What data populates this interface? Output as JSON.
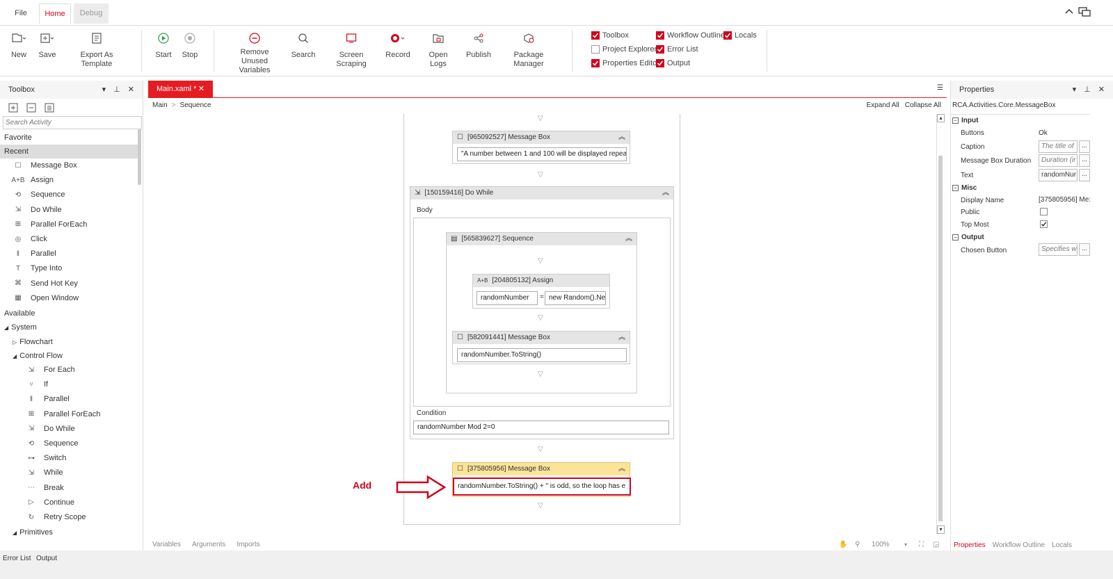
{
  "tabs": {
    "file": "File",
    "home": "Home",
    "debug": "Debug"
  },
  "ribbon": {
    "new": "New",
    "save": "Save",
    "export_template": "Export As Template",
    "start": "Start",
    "stop": "Stop",
    "remove_unused": "Remove Unused Variables",
    "search": "Search",
    "screen_scraping": "Screen Scraping",
    "record": "Record",
    "open_logs": "Open Logs",
    "publish": "Publish",
    "package_manager": "Package Manager",
    "toggles": {
      "toolbox": {
        "label": "Toolbox",
        "checked": true
      },
      "workflow_outline": {
        "label": "Workflow Outline",
        "checked": true
      },
      "locals": {
        "label": "Locals",
        "checked": true
      },
      "project_explorer": {
        "label": "Project Explorer",
        "checked": false
      },
      "error_list": {
        "label": "Error List",
        "checked": true
      },
      "properties_editor": {
        "label": "Properties Editor",
        "checked": true
      },
      "output": {
        "label": "Output",
        "checked": true
      }
    }
  },
  "toolbox": {
    "title": "Toolbox",
    "search_placeholder": "Search Activity",
    "favorite": "Favorite",
    "recent": "Recent",
    "recent_items": [
      "Message Box",
      "Assign",
      "Sequence",
      "Do While",
      "Parallel ForEach",
      "Click",
      "Parallel",
      "Type Into",
      "Send Hot Key",
      "Open Window"
    ],
    "available": "Available",
    "system": "System",
    "flowchart": "Flowchart",
    "control_flow": "Control Flow",
    "control_flow_items": [
      "For Each",
      "If",
      "Parallel",
      "Parallel ForEach",
      "Do While",
      "Sequence",
      "Switch",
      "While",
      "Break",
      "Continue",
      "Retry Scope"
    ],
    "primitives": "Primitives"
  },
  "designer": {
    "doc_tab": "Main.xaml *",
    "breadcrumb_main": "Main",
    "breadcrumb_sep": ">",
    "breadcrumb_sequence": "Sequence",
    "expand_all": "Expand All",
    "collapse_all": "Collapse All",
    "msgbox1_title": "[965092527] Message Box",
    "msgbox1_text": "\"A number between 1 and 100 will be displayed repeat",
    "dowhile_title": "[150159416] Do While",
    "body_label": "Body",
    "seq_title": "[565839627] Sequence",
    "assign_title": "[204805132] Assign",
    "assign_to": "randomNumber",
    "assign_eq": "=",
    "assign_value": "new Random().Ne:",
    "msgbox2_title": "[582091441] Message Box",
    "msgbox2_text": "randomNumber.ToString()",
    "condition_label": "Condition",
    "condition_value": "randomNumber Mod 2=0",
    "msgbox3_title": "[375805956] Message Box",
    "msgbox3_text": "randomNumber.ToString() + \" is odd, so the loop has e",
    "annotation": "Add",
    "bottom_tabs": [
      "Variables",
      "Arguments",
      "Imports"
    ],
    "zoom": "100%"
  },
  "properties": {
    "title": "Properties",
    "subtitle": "RCA.Activities.Core.MessageBox",
    "input": "Input",
    "buttons_label": "Buttons",
    "buttons_value": "Ok",
    "caption_label": "Caption",
    "caption_placeholder": "The title of",
    "duration_label": "Message Box Duration",
    "duration_placeholder": "Duration (ir",
    "text_label": "Text",
    "text_value": "randomNur",
    "misc": "Misc",
    "display_name_label": "Display Name",
    "display_name_value": "[375805956] Me:",
    "public_label": "Public",
    "public_checked": false,
    "top_most_label": "Top Most",
    "top_most_checked": true,
    "output": "Output",
    "chosen_button_label": "Chosen Button",
    "chosen_button_placeholder": "Specifies wh",
    "ellipsis": "...",
    "bottom_tabs": [
      "Properties",
      "Workflow Outline",
      "Locals"
    ]
  },
  "statusbar": {
    "error_list": "Error List",
    "output": "Output"
  },
  "colors": {
    "accent": "#d0021b",
    "tab_red": "#e51c23",
    "selected_header": "#fbe49a"
  }
}
